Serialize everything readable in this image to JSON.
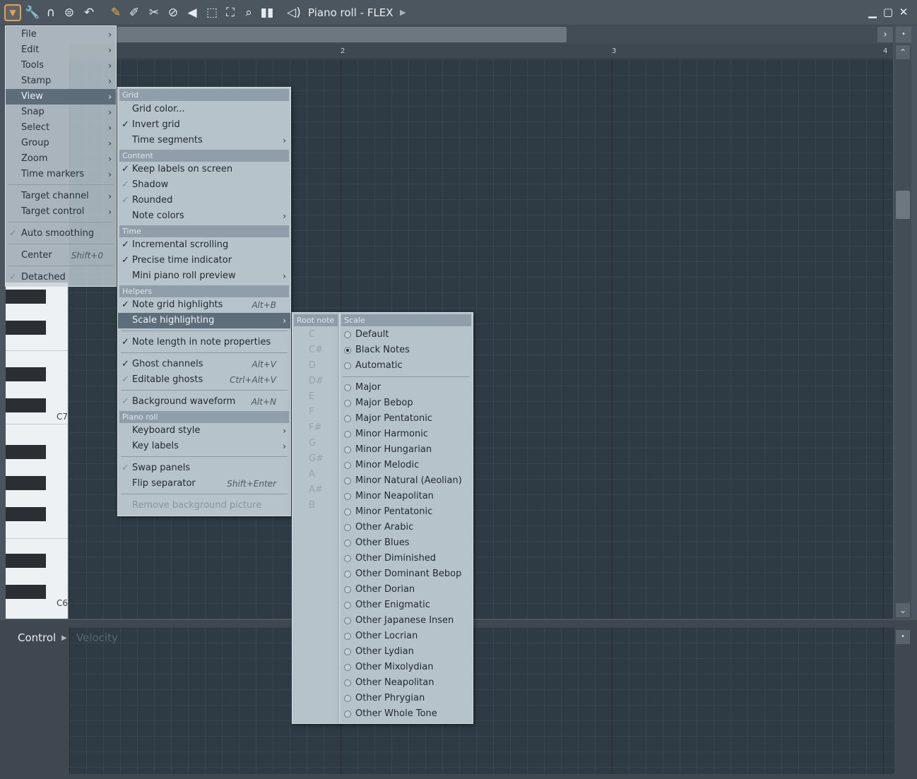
{
  "title_bar": {
    "title": "Piano roll - FLEX",
    "icons": [
      "menu-arrow-icon",
      "wrench-icon",
      "magnet-icon",
      "play-mode-icon",
      "undo-icon",
      "pencil-icon",
      "paint-icon",
      "delete-icon",
      "mute-icon",
      "slice-icon",
      "select-icon",
      "zoom-icon",
      "playback-icon",
      "speaker-icon"
    ]
  },
  "ruler": {
    "bars": [
      "2",
      "3",
      "4"
    ]
  },
  "keyboard": {
    "labels": [
      "C7",
      "C6"
    ]
  },
  "control": {
    "label": "Control",
    "target": "Velocity"
  },
  "main_menu": {
    "items": [
      {
        "label": "File",
        "submenu": true
      },
      {
        "label": "Edit",
        "submenu": true
      },
      {
        "label": "Tools",
        "submenu": true
      },
      {
        "label": "Stamp",
        "submenu": true
      },
      {
        "label": "View",
        "submenu": true,
        "highlighted": true
      },
      {
        "label": "Snap",
        "submenu": true
      },
      {
        "label": "Select",
        "submenu": true
      },
      {
        "label": "Group",
        "submenu": true
      },
      {
        "label": "Zoom",
        "submenu": true
      },
      {
        "label": "Time markers",
        "submenu": true
      },
      {
        "label": "Target channel",
        "submenu": true
      },
      {
        "label": "Target control",
        "submenu": true
      },
      {
        "label": "Auto smoothing",
        "checked": true
      },
      {
        "label": "Center",
        "shortcut": "Shift+0"
      },
      {
        "label": "Detached",
        "checked": true
      }
    ]
  },
  "view_menu": {
    "sections": {
      "grid": "Grid",
      "content": "Content",
      "time": "Time",
      "helpers": "Helpers",
      "piano_roll": "Piano roll"
    },
    "items": [
      {
        "label": "Grid color..."
      },
      {
        "label": "Invert grid",
        "checked": true
      },
      {
        "label": "Time segments",
        "submenu": true
      },
      {
        "label": "Keep labels on screen",
        "checked": true
      },
      {
        "label": "Shadow",
        "checked": "dim"
      },
      {
        "label": "Rounded",
        "checked": "dim"
      },
      {
        "label": "Note colors",
        "submenu": true
      },
      {
        "label": "Incremental scrolling",
        "checked": true
      },
      {
        "label": "Precise time indicator",
        "checked": true
      },
      {
        "label": "Mini piano roll preview",
        "submenu": true
      },
      {
        "label": "Note grid highlights",
        "checked": true,
        "shortcut": "Alt+B"
      },
      {
        "label": "Scale highlighting",
        "submenu": true,
        "highlighted": true
      },
      {
        "label": "Note length in note properties",
        "checked": true
      },
      {
        "label": "Ghost channels",
        "checked": true,
        "shortcut": "Alt+V"
      },
      {
        "label": "Editable ghosts",
        "checked": "dim",
        "shortcut": "Ctrl+Alt+V"
      },
      {
        "label": "Background waveform",
        "checked": "dim",
        "shortcut": "Alt+N"
      },
      {
        "label": "Keyboard style",
        "submenu": true
      },
      {
        "label": "Key labels",
        "submenu": true
      },
      {
        "label": "Swap panels",
        "checked": "dim"
      },
      {
        "label": "Flip separator",
        "shortcut": "Shift+Enter"
      },
      {
        "label": "Remove background picture",
        "disabled": true
      }
    ]
  },
  "root_note_menu": {
    "header": "Root note",
    "notes": [
      "C",
      "C#",
      "D",
      "D#",
      "E",
      "F",
      "F#",
      "G",
      "G#",
      "A",
      "A#",
      "B"
    ]
  },
  "scale_menu": {
    "header": "Scale",
    "selected": "Black Notes",
    "top_items": [
      "Default",
      "Black Notes",
      "Automatic"
    ],
    "scales": [
      "Major",
      "Major Bebop",
      "Major Pentatonic",
      "Minor Harmonic",
      "Minor Hungarian",
      "Minor Melodic",
      "Minor Natural (Aeolian)",
      "Minor Neapolitan",
      "Minor Pentatonic",
      "Other Arabic",
      "Other Blues",
      "Other Diminished",
      "Other Dominant Bebop",
      "Other Dorian",
      "Other Enigmatic",
      "Other Japanese Insen",
      "Other Locrian",
      "Other Lydian",
      "Other Mixolydian",
      "Other Neapolitan",
      "Other Phrygian",
      "Other Whole Tone"
    ]
  },
  "colors": {
    "accent": "#f0a040",
    "grid_bg": "#2e3b45",
    "menu_bg": "#b7c3cb",
    "menu_highlight": "#5d6d79"
  }
}
